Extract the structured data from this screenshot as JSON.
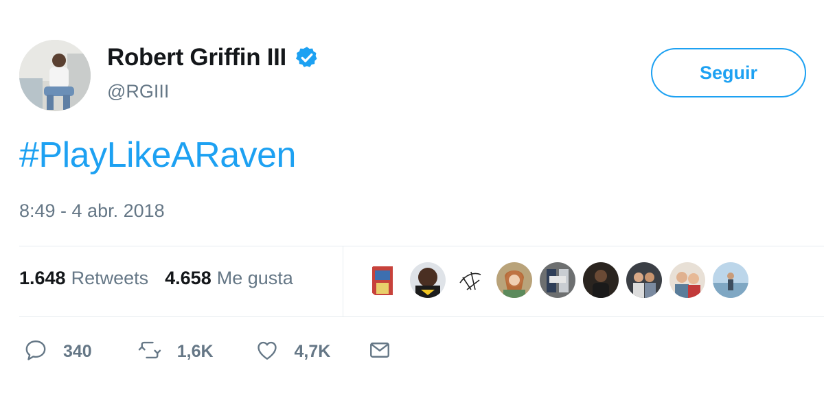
{
  "user": {
    "name": "Robert Griffin III",
    "handle": "@RGIII",
    "verified": true
  },
  "follow_button": {
    "label": "Seguir"
  },
  "tweet": {
    "text": "#PlayLikeARaven",
    "timestamp": "8:49 - 4 abr. 2018"
  },
  "stats": {
    "retweets_count": "1.648",
    "retweets_label": "Retweets",
    "likes_count": "4.658",
    "likes_label": "Me gusta"
  },
  "actions": {
    "replies": "340",
    "retweets": "1,6K",
    "likes": "4,7K"
  },
  "colors": {
    "accent": "#1da1f2",
    "muted": "#657786",
    "text": "#14171a",
    "divider": "#e6ecf0"
  },
  "icons": [
    "verified-badge-icon",
    "reply-icon",
    "retweet-icon",
    "heart-icon",
    "direct-message-icon"
  ]
}
